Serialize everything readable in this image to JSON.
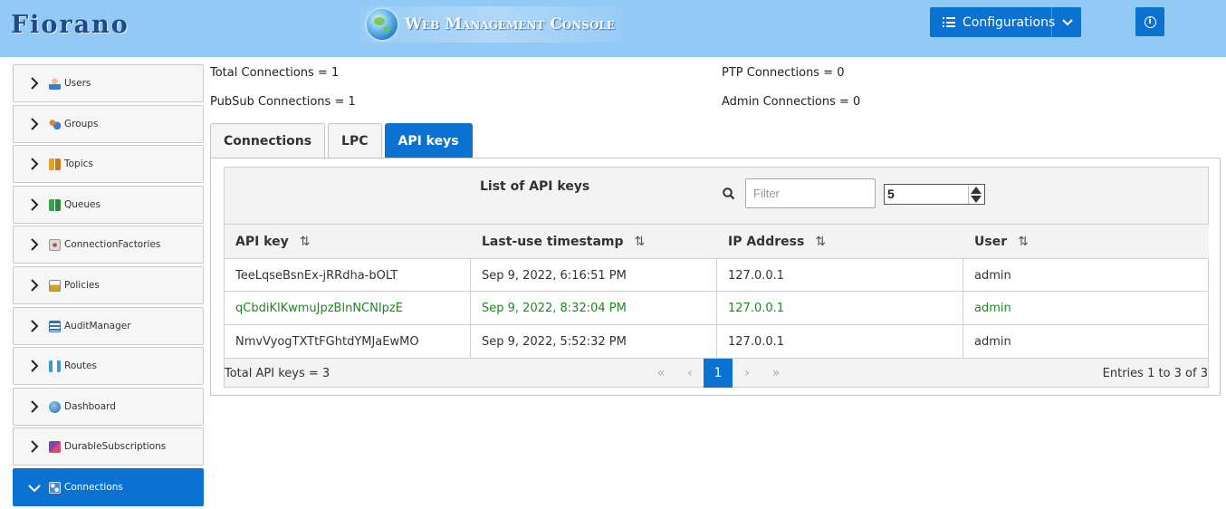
{
  "header": {
    "logo_text": "Fiorano",
    "console_title": "Web Management Console",
    "config_button": "Configurations",
    "info_icon": "info-icon"
  },
  "sidebar": {
    "items": [
      {
        "label": "Users",
        "icon": "user-icon",
        "color": "#3a7bd5"
      },
      {
        "label": "Groups",
        "icon": "groups-icon",
        "color": "#d48a2a"
      },
      {
        "label": "Topics",
        "icon": "topics-icon",
        "color": "#e8a020"
      },
      {
        "label": "Queues",
        "icon": "queues-icon",
        "color": "#3aa04a"
      },
      {
        "label": "ConnectionFactories",
        "icon": "connection-factories-icon",
        "color": "#c04a4a"
      },
      {
        "label": "Policies",
        "icon": "policies-icon",
        "color": "#d8a020"
      },
      {
        "label": "AuditManager",
        "icon": "audit-manager-icon",
        "color": "#3a6fb0"
      },
      {
        "label": "Routes",
        "icon": "routes-icon",
        "color": "#3a9ad5"
      },
      {
        "label": "Dashboard",
        "icon": "dashboard-icon",
        "color": "#2a6aa8"
      },
      {
        "label": "DurableSubscriptions",
        "icon": "durable-subscriptions-icon",
        "color": "#7a4ab0"
      },
      {
        "label": "Connections",
        "icon": "connections-icon",
        "color": "#e0e0e0",
        "active": true
      }
    ]
  },
  "stats": {
    "total": "Total Connections = 1",
    "ptp": "PTP Connections = 0",
    "pubsub": "PubSub Connections = 1",
    "admin": "Admin Connections = 0"
  },
  "tabs": [
    {
      "label": "Connections",
      "active": false
    },
    {
      "label": "LPC",
      "active": false
    },
    {
      "label": "API keys",
      "active": true
    }
  ],
  "table": {
    "title": "List of API keys",
    "filter_placeholder": "Filter",
    "rows_per_page": "5",
    "columns": [
      "API key",
      "Last-use timestamp",
      "IP Address",
      "User"
    ],
    "rows": [
      [
        "TeeLqseBsnEx-jRRdha-bOLT",
        "Sep 9, 2022, 6:16:51 PM",
        "127.0.0.1",
        "admin"
      ],
      [
        "qCbdiKlKwmuJpzBlnNCNIpzE",
        "Sep 9, 2022, 8:32:04 PM",
        "127.0.0.1",
        "admin"
      ],
      [
        "NmvVyogTXTtFGhtdYMJaEwMO",
        "Sep 9, 2022, 5:52:32 PM",
        "127.0.0.1",
        "admin"
      ]
    ],
    "highlight_color": "#1b8a1b",
    "total_label": "Total API keys = 3",
    "pagination": {
      "first": "«",
      "prev": "‹",
      "current": "1",
      "next": "›",
      "last": "»"
    },
    "entries_label": "Entries 1 to 3 of 3"
  },
  "colors": {
    "accent": "#0b72d1",
    "header_bg": "#92c9f5"
  }
}
